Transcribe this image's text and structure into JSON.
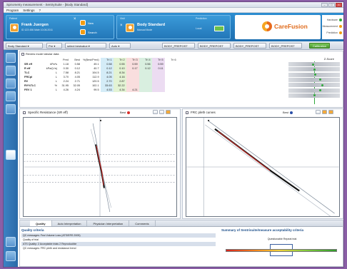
{
  "window": {
    "title": "Spirometry measurement - SentrySuite - [Body Standard]"
  },
  "menu": [
    "Program",
    "Settings",
    "?"
  ],
  "header": {
    "patient_label": "Patient",
    "patient_name": "Frank Juergen",
    "patient_sub": "ID 123 456 Male 10.06.2011",
    "new_label": "New",
    "search_label": "Search",
    "visit_label": "Visit",
    "visit_name": "Body Standard",
    "visit_sub": "Manual Mode",
    "prediction_label": "Prediction",
    "prediction_value": "Local",
    "brand": "CareFusion",
    "status_items": [
      {
        "label": "Hardware",
        "color": "#2ea83a"
      },
      {
        "label": "Measurement",
        "color": "#f39c12"
      },
      {
        "label": "Prediction",
        "color": "#f39c12"
      }
    ]
  },
  "toolbar": {
    "test_select": "Body Standard",
    "zoom": "Pre",
    "curve_select": "select bestvalue",
    "mode_select": "Auto",
    "buttons": [
      "BODY_PREPOST",
      "BODY_PREPOST",
      "BODY_PREPOST",
      "BODY_PREPOST"
    ],
    "action": "Calibration"
  },
  "table": {
    "title": "Review mode tabular data",
    "headers": [
      "",
      "",
      "Pred",
      "Best",
      "%(Best/Pred)",
      "Tri 1",
      "Tri 2",
      "Tri 3",
      "Tri 4",
      "Tri 5",
      "Tri 6"
    ],
    "rows": [
      [
        "SR eff",
        "kPa*s",
        "1.18",
        "0.58",
        "49.1",
        "0.58",
        "0.55",
        "0.59",
        "0.56",
        "0.59",
        ""
      ],
      [
        "R eff",
        "kPa/(L/s)",
        "0.30",
        "0.12",
        "40.7",
        "0.12",
        "0.10",
        "0.17",
        "0.12",
        "0.11",
        ""
      ],
      [
        "TLC",
        "L",
        "7.58",
        "8.21",
        "104.5",
        "8.21",
        "8.34",
        "",
        "",
        "",
        ""
      ],
      [
        "FRCpl",
        "L",
        "3.70",
        "4.05",
        "112.9",
        "4.05",
        "4.16",
        "",
        "",
        "",
        ""
      ],
      [
        "RV",
        "L",
        "2.24",
        "2.71",
        "120.5",
        "2.70",
        "2.87",
        "",
        "",
        "",
        ""
      ],
      [
        "RV%TLC",
        "%",
        "31.95",
        "32.05",
        "102.1",
        "33.63",
        "32.22",
        "",
        "",
        "",
        ""
      ],
      [
        "FEV 1",
        "L",
        "4.26",
        "4.24",
        "99.5",
        "4.53",
        "4.34",
        "4.21",
        "",
        "",
        ""
      ]
    ],
    "zscore_title": "Z-Score",
    "zscore_markers": [
      0.48,
      0.5,
      0.52,
      0.62,
      0.66,
      0.62,
      0.5
    ]
  },
  "chart_left": {
    "title": "Specific Resistance (SR eff)",
    "best_label": "Best",
    "best_color": "#d9302b"
  },
  "chart_right": {
    "title": "FRC pleth curves",
    "best_label": "Best",
    "best_color": "#2b4fa8"
  },
  "bottom": {
    "tabs": [
      "Quality",
      "Auto Interpretation",
      "Physician Interpretation",
      "Comments"
    ],
    "qc_head": "Quality criteria",
    "qc_rows": [
      "QC messages: Few Volume Loss (ATS/ERS 2005)",
      "Quality of trial",
      "ATS Quality: 2 Acceptable trials  2 Reproducible",
      "QC messages: FRC pleth and resistance trend"
    ],
    "summary_title": "Summary of Sentrisuite/measure acceptability criteria",
    "summary_marker_label": "Questionable Repeat trial"
  }
}
